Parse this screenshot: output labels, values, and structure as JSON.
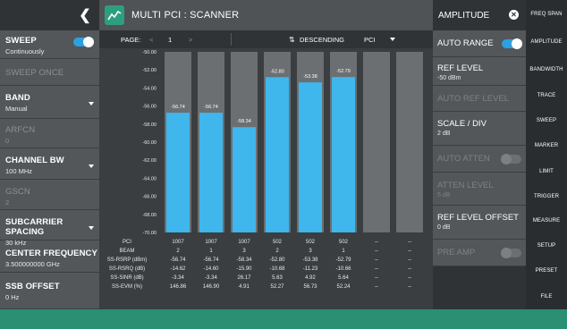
{
  "window": {
    "title": "MULTI PCI : SCANNER",
    "back_icon": "chevron-left-icon"
  },
  "left_panel": {
    "sweep": {
      "label": "SWEEP",
      "value": "Continuously",
      "toggle_on": true
    },
    "sweep_once": {
      "label": "SWEEP ONCE"
    },
    "band": {
      "label": "BAND",
      "value": "Manual"
    },
    "arfcn": {
      "label": "ARFCN",
      "value": "0"
    },
    "channel_bw": {
      "label": "CHANNEL BW",
      "value": "100 MHz"
    },
    "gscn": {
      "label": "GSCN",
      "value": "2"
    },
    "subcarrier_spacing": {
      "label": "SUBCARRIER SPACING",
      "value": "30 kHz"
    },
    "center_frequency": {
      "label": "CENTER FREQUENCY",
      "value": "3.500000000 GHz"
    },
    "ssb_offset": {
      "label": "SSB OFFSET",
      "value": "0 Hz"
    }
  },
  "pagebar": {
    "page_label": "PAGE:",
    "page_prev": "<",
    "page_number": "1",
    "page_next": ">",
    "sort_label": "DESCENDING",
    "sort_field": "PCI"
  },
  "chart_data": {
    "type": "bar",
    "categories": [
      "1007",
      "1007",
      "1007",
      "502",
      "502",
      "502",
      "--",
      "--"
    ],
    "values": [
      -56.74,
      -56.74,
      -58.34,
      -52.8,
      -53.38,
      -52.79,
      null,
      null
    ],
    "labels": [
      "-56.74",
      "-56.74",
      "-58.34",
      "-52.80",
      "-53.38",
      "-52.79",
      "",
      ""
    ],
    "ylim": [
      -70,
      -50
    ],
    "yticks": [
      "-50.00",
      "-52.00",
      "-54.00",
      "-56.00",
      "-58.00",
      "-60.00",
      "-62.00",
      "-64.00",
      "-66.00",
      "-68.00",
      "-70.00"
    ],
    "bar_color": "#3fb6ec",
    "column_color": "#6b6f71"
  },
  "table": {
    "row_labels": [
      "PCI",
      "BEAM",
      "SS-RSRP (dBm)",
      "SS-RSRQ (dB)",
      "SS-SINR (dB)",
      "SS-EVM (%)"
    ],
    "columns": [
      [
        "1007",
        "2",
        "-56.74",
        "-14.62",
        "-3.34",
        "146.86"
      ],
      [
        "1007",
        "1",
        "-56.74",
        "-14.60",
        "-3.34",
        "146.90"
      ],
      [
        "1007",
        "3",
        "-58.34",
        "-15.90",
        "26.17",
        "4.91"
      ],
      [
        "502",
        "2",
        "-52.80",
        "-10.68",
        "5.63",
        "52.27"
      ],
      [
        "502",
        "3",
        "-53.38",
        "-11.23",
        "4.92",
        "56.73"
      ],
      [
        "502",
        "1",
        "-52.79",
        "-10.66",
        "5.64",
        "52.24"
      ],
      [
        "--",
        "--",
        "--",
        "--",
        "--",
        "--"
      ],
      [
        "--",
        "--",
        "--",
        "--",
        "--",
        "--"
      ]
    ]
  },
  "amplitude_panel": {
    "header": "AMPLITUDE",
    "auto_range": {
      "label": "AUTO RANGE",
      "toggle_on": true
    },
    "ref_level": {
      "label": "REF LEVEL",
      "value": "-50 dBm"
    },
    "auto_ref_level": {
      "label": "AUTO REF LEVEL"
    },
    "scale_div": {
      "label": "SCALE / DIV",
      "value": "2 dB"
    },
    "auto_atten": {
      "label": "AUTO ATTEN",
      "toggle_on": false
    },
    "atten_level": {
      "label": "ATTEN LEVEL",
      "value": "5 dB"
    },
    "ref_level_offset": {
      "label": "REF LEVEL OFFSET",
      "value": "0 dB"
    },
    "pre_amp": {
      "label": "PRE AMP",
      "toggle_on": false
    }
  },
  "menu": [
    "FREQ SPAN",
    "AMPLITUDE",
    "BANDWIDTH",
    "TRACE",
    "SWEEP",
    "MARKER",
    "LIMIT",
    "TRIGGER",
    "MEASURE",
    "SETUP",
    "PRESET",
    "FILE"
  ],
  "colors": {
    "accent": "#2ea0e0",
    "footer": "#2a8f73",
    "bar": "#3fb6ec"
  }
}
